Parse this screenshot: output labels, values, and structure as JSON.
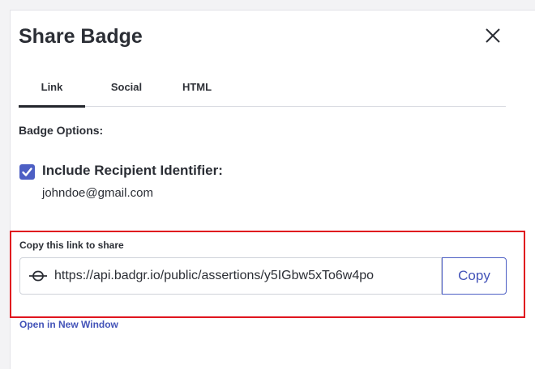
{
  "modal": {
    "title": "Share Badge",
    "close_icon": "close-icon"
  },
  "tabs": [
    {
      "label": "Link",
      "active": true
    },
    {
      "label": "Social",
      "active": false
    },
    {
      "label": "HTML",
      "active": false
    }
  ],
  "badge_options": {
    "heading": "Badge Options:",
    "include_identifier": {
      "label": "Include Recipient Identifier:",
      "checked": true
    },
    "email": "johndoe@gmail.com"
  },
  "share_link": {
    "label": "Copy this link to share",
    "icon": "link-icon",
    "url": "https://api.badgr.io/public/assertions/y5IGbw5xTo6w4po",
    "copy_label": "Copy"
  },
  "open_new_window": "Open in New Window",
  "colors": {
    "accent": "#4d5fc4",
    "link": "#4353b8",
    "highlight": "#e0141e"
  }
}
